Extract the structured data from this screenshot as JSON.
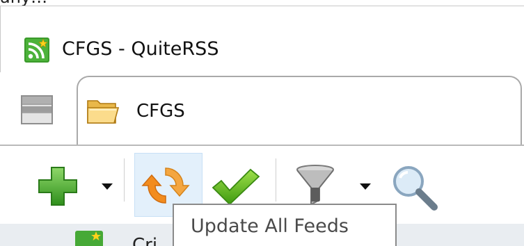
{
  "window": {
    "title": "CFGS - QuiteRSS",
    "clipped_text_above": "any…"
  },
  "tabs": [
    {
      "label": "CFGS",
      "icon": "folder-icon",
      "active": true
    }
  ],
  "toolbar": {
    "buttons": [
      {
        "name": "add-button",
        "icon": "plus-icon",
        "has_dropdown": true
      },
      {
        "name": "update-all-feeds-button",
        "icon": "refresh-icon",
        "hovered": true
      },
      {
        "name": "mark-all-read-button",
        "icon": "checkmark-icon"
      },
      {
        "name": "filter-button",
        "icon": "funnel-icon",
        "has_dropdown": true
      },
      {
        "name": "search-button",
        "icon": "magnifier-icon"
      }
    ]
  },
  "tooltip": {
    "text": "Update All Feeds"
  },
  "feed_list": {
    "partial_item_text": "Cri"
  },
  "colors": {
    "plus_green": "#4aa631",
    "refresh_orange": "#f39a2b",
    "check_green": "#5cb11c",
    "hover_bg": "#e3f0fb",
    "rss_green": "#3a9a2a"
  }
}
